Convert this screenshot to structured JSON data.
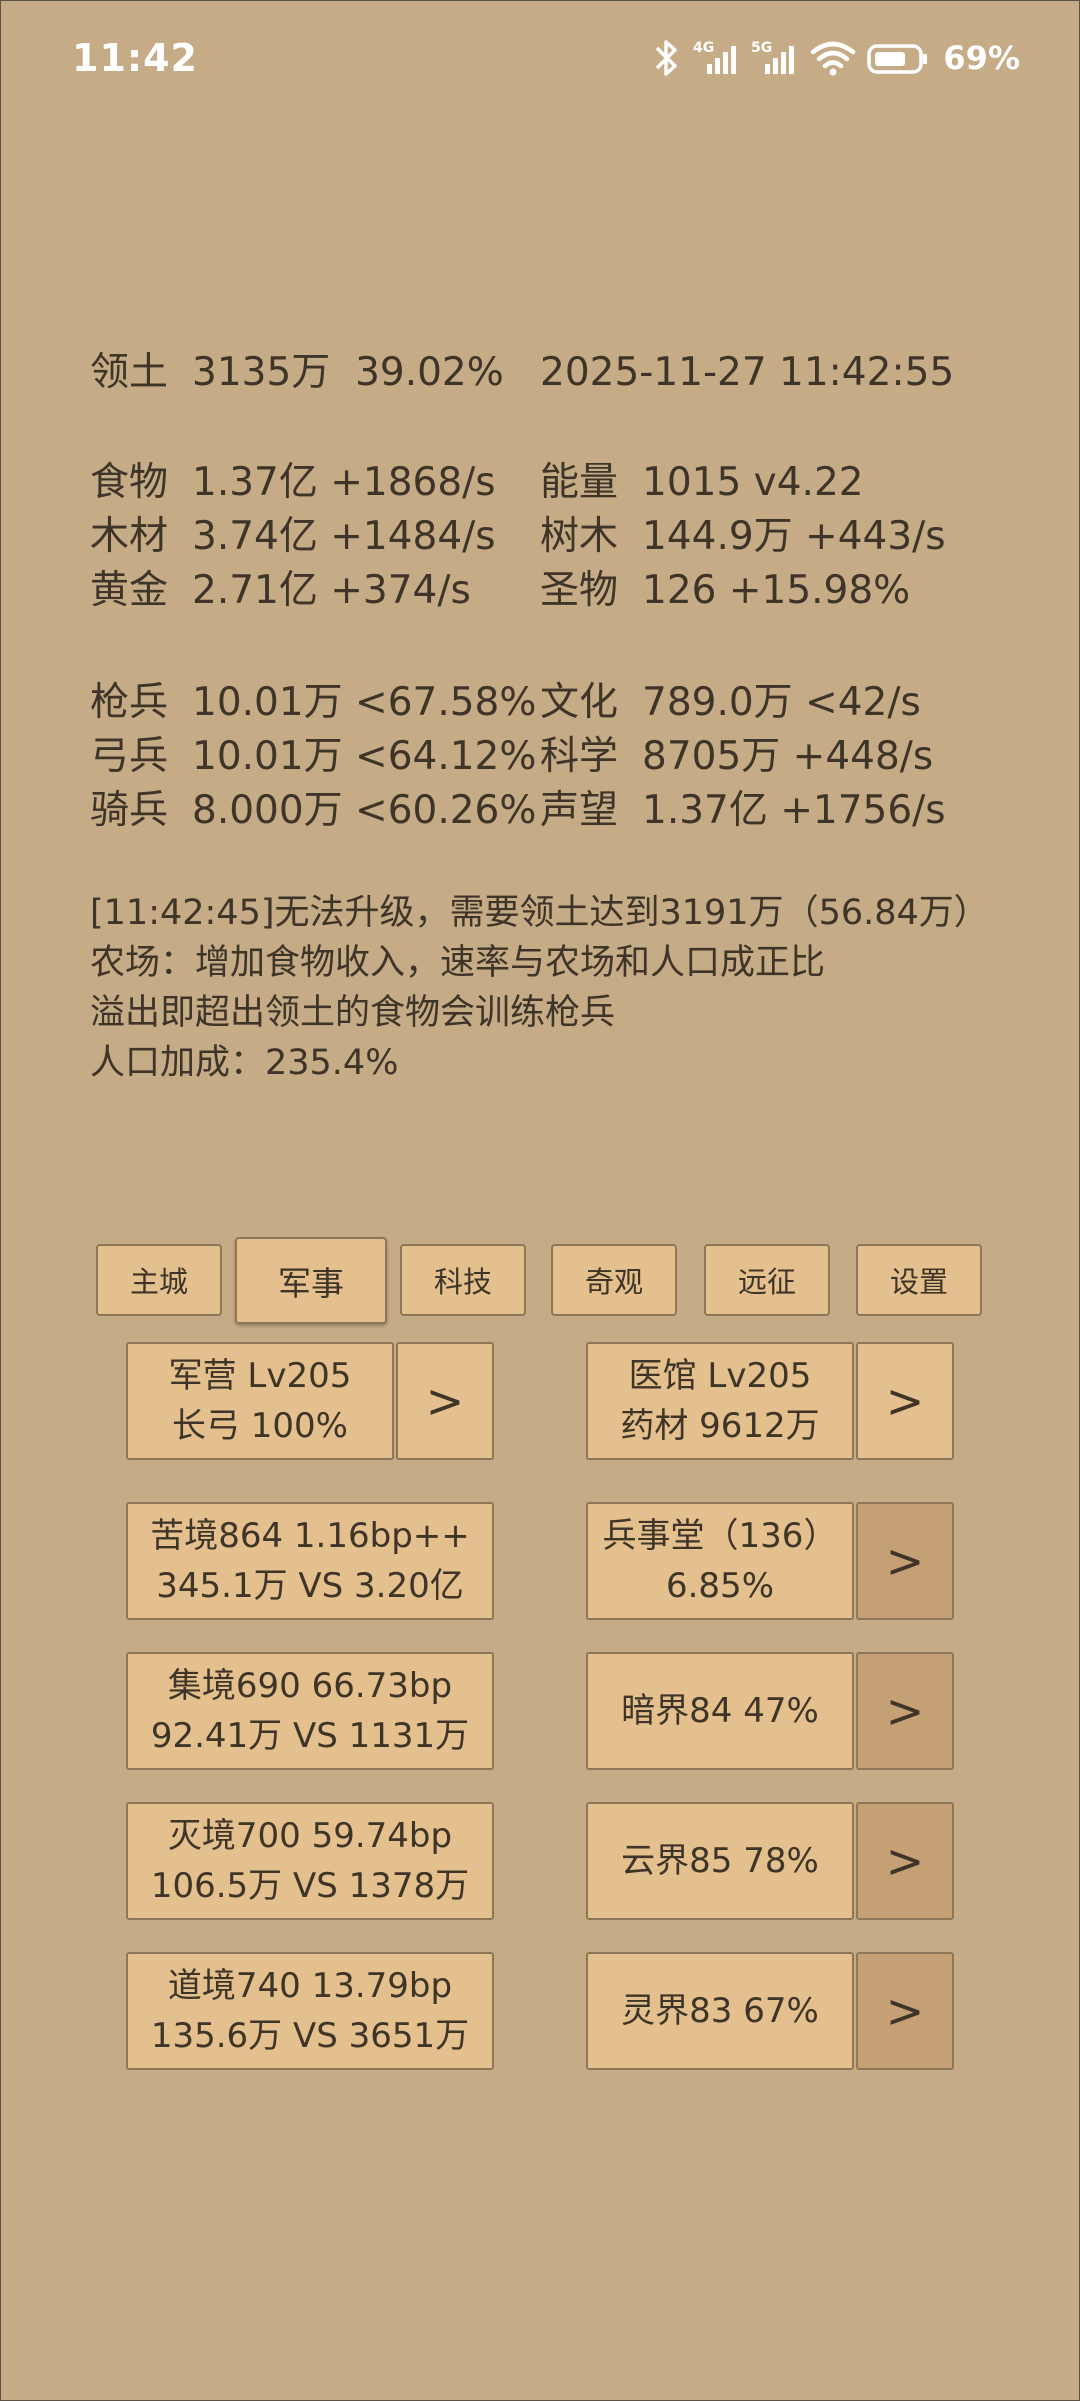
{
  "status_bar": {
    "time": "11:42",
    "battery_percent": "69%",
    "network_1": "4G",
    "network_2": "5G"
  },
  "territory": {
    "label": "领土",
    "value": "3135万",
    "percent": "39.02%",
    "datetime": "2025-11-27 11:42:55"
  },
  "resources": [
    {
      "label": "食物",
      "value": "1.37亿 +1868/s"
    },
    {
      "label": "木材",
      "value": "3.74亿 +1484/s"
    },
    {
      "label": "黄金",
      "value": "2.71亿 +374/s"
    }
  ],
  "resources_right": [
    {
      "label": "能量",
      "value": "1015  v4.22"
    },
    {
      "label": "树木",
      "value": "144.9万 +443/s"
    },
    {
      "label": "圣物",
      "value": "126 +15.98%"
    }
  ],
  "troops": [
    {
      "label": "枪兵",
      "value": "10.01万 <67.58%"
    },
    {
      "label": "弓兵",
      "value": "10.01万 <64.12%"
    },
    {
      "label": "骑兵",
      "value": "8.000万 <60.26%"
    }
  ],
  "culture": [
    {
      "label": "文化",
      "value": "789.0万 <42/s"
    },
    {
      "label": "科学",
      "value": "8705万 +448/s"
    },
    {
      "label": "声望",
      "value": "1.37亿 +1756/s"
    }
  ],
  "messages": [
    "[11:42:45]无法升级，需要领土达到3191万（56.84万）",
    "农场：增加食物收入，速率与农场和人口成正比",
    "溢出即超出领土的食物会训练枪兵",
    "人口加成：235.4%"
  ],
  "tabs": [
    "主城",
    "军事",
    "科技",
    "奇观",
    "远征",
    "设置"
  ],
  "active_tab": "军事",
  "arrow_label": ">",
  "barracks": {
    "line1": "军营 Lv205",
    "line2": "长弓 100%"
  },
  "hospital": {
    "line1": "医馆 Lv205",
    "line2": "药材 9612万"
  },
  "realms_left": [
    {
      "line1": "苦境864  1.16bp++",
      "line2": "345.1万 VS 3.20亿"
    },
    {
      "line1": "集境690  66.73bp",
      "line2": "92.41万 VS 1131万"
    },
    {
      "line1": "灭境700  59.74bp",
      "line2": "106.5万 VS 1378万"
    },
    {
      "line1": "道境740  13.79bp",
      "line2": "135.6万 VS 3651万"
    }
  ],
  "realms_right": [
    {
      "line1": "兵事堂（136）",
      "line2": "6.85%"
    },
    {
      "line1": "暗界84  47%",
      "line2": ""
    },
    {
      "line1": "云界85  78%",
      "line2": ""
    },
    {
      "line1": "灵界83  67%",
      "line2": ""
    }
  ]
}
